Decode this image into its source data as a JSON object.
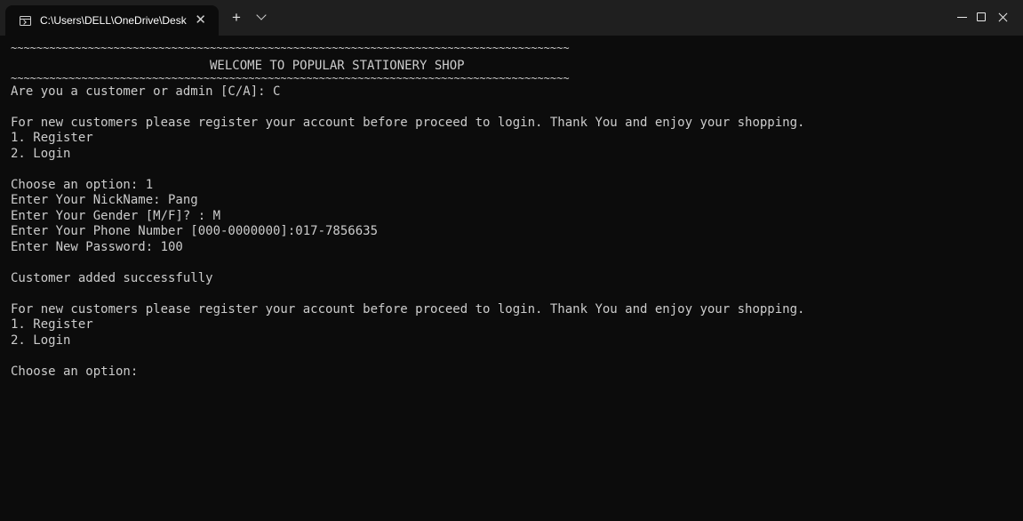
{
  "tab": {
    "title": "C:\\Users\\DELL\\OneDrive\\Desk",
    "close_glyph": "✕",
    "new_tab_glyph": "+"
  },
  "icons": {
    "terminal": "terminal-icon",
    "dropdown": "chevron-down-icon",
    "minimize": "minimize-icon",
    "maximize": "maximize-icon",
    "close": "close-icon"
  },
  "colors": {
    "background": "#0c0c0c",
    "titlebar": "#1f1f1f",
    "text": "#cccccc"
  },
  "console": {
    "line1": "~~~~~~~~~~~~~~~~~~~~~~~~~~~~~~~~~~~~~~~~~~~~~~~~~~~~~~~~~~~~~~~~~~~~~~~~~~~~~~~~~~~~~~~",
    "line2": "WELCOME TO POPULAR STATIONERY SHOP",
    "line3": "~~~~~~~~~~~~~~~~~~~~~~~~~~~~~~~~~~~~~~~~~~~~~~~~~~~~~~~~~~~~~~~~~~~~~~~~~~~~~~~~~~~~~~~",
    "line4": "Are you a customer or admin [C/A]: C",
    "line5": "",
    "line6": "For new customers please register your account before proceed to login. Thank You and enjoy your shopping.",
    "line7": "1. Register",
    "line8": "2. Login",
    "line9": "",
    "line10": "Choose an option: 1",
    "line11": "Enter Your NickName: Pang",
    "line12": "Enter Your Gender [M/F]? : M",
    "line13": "Enter Your Phone Number [000-0000000]:017-7856635",
    "line14": "Enter New Password: 100",
    "line15": "",
    "line16": "Customer added successfully",
    "line17": "",
    "line18": "For new customers please register your account before proceed to login. Thank You and enjoy your shopping.",
    "line19": "1. Register",
    "line20": "2. Login",
    "line21": "",
    "line22": "Choose an option:"
  }
}
